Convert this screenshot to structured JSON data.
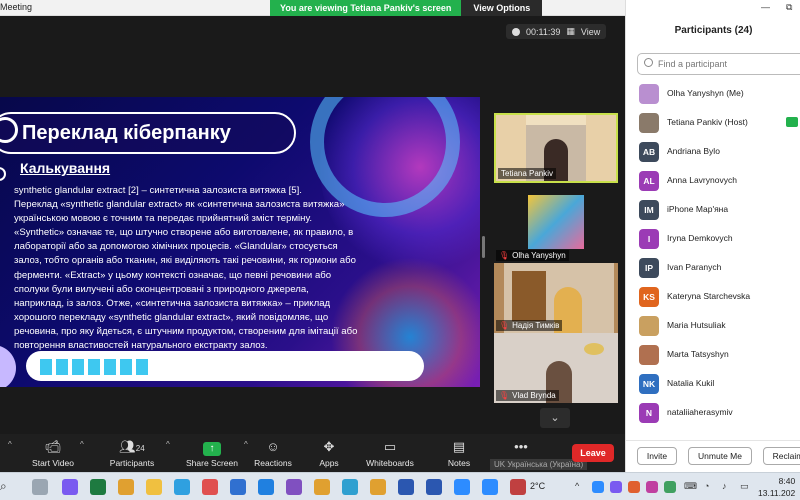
{
  "window": {
    "title": "Meeting"
  },
  "banner": {
    "message": "You are viewing Tetiana Pankiv's screen",
    "view_options": "View Options"
  },
  "meeting": {
    "timer": "00:11:39",
    "view_label": "View"
  },
  "slide": {
    "title": "Переклад кіберпанку",
    "subtitle": "Калькування",
    "lines": [
      " synthetic glandular extract [2] – синтетична залозиста витяжка [5].",
      "Переклад «synthetic glandular extract» як «синтетична залозиста витяжка»",
      "українською мовою є точним та передає прийнятний зміст терміну.",
      "«Synthetic» означає те, що штучно створене або виготовлене, як правило, в",
      "лабораторії або за допомогою хімічних процесів. «Glandular» стосується",
      "залоз, тобто органів або тканин, які виділяють такі речовини, як гормони або",
      "ферменти. «Extract» у цьому контексті означає, що певні речовини або",
      "сполуки були вилучені або сконцентровані з природного джерела,",
      "наприклад, із залоз. Отже, «синтетична залозиста витяжка» – приклад",
      "хорошого перекладу «synthetic glandular extract», який повідомляє, що",
      "речовина, про яку йдеться, є штучним продуктом, створеним для імітації або",
      "повторення властивостей натурального екстракту залоз."
    ],
    "progress_segments": 7
  },
  "tiles": [
    {
      "name": "Tetiana Pankiv",
      "muted": false
    },
    {
      "name": "Olha Yanyshyn",
      "muted": true
    },
    {
      "name": "Надія Тимків",
      "muted": true
    },
    {
      "name": "Vlad Brynda",
      "muted": true
    }
  ],
  "toolbar": {
    "video": "Start Video",
    "participants": "Participants",
    "participants_count": "24",
    "share": "Share Screen",
    "reactions": "Reactions",
    "apps": "Apps",
    "whiteboards": "Whiteboards",
    "notes": "Notes",
    "leave": "Leave",
    "lang_tip": "UK Українська (Україна)"
  },
  "panel": {
    "title": "Participants (24)",
    "search_placeholder": "Find a participant",
    "participants": [
      {
        "name": "Olha Yanyshyn (Me)",
        "initials": "",
        "color": "#b98fd0"
      },
      {
        "name": "Tetiana Pankiv (Host)",
        "initials": "",
        "color": "#8a7a6a"
      },
      {
        "name": "Andriana Bylo",
        "initials": "AB",
        "color": "#3d4a5c"
      },
      {
        "name": "Anna Lavrynovych",
        "initials": "AL",
        "color": "#9b3bb5"
      },
      {
        "name": "iPhone Мар'яна",
        "initials": "IM",
        "color": "#3d4a5c"
      },
      {
        "name": "Iryna Demkovych",
        "initials": "I",
        "color": "#9b3bb5"
      },
      {
        "name": "Ivan Paranych",
        "initials": "IP",
        "color": "#3d4a5c"
      },
      {
        "name": "Kateryna Starchevska",
        "initials": "KS",
        "color": "#e0651e"
      },
      {
        "name": "Maria Hutsuliak",
        "initials": "",
        "color": "#c9a060"
      },
      {
        "name": "Marta Tatsyshyn",
        "initials": "",
        "color": "#b07050"
      },
      {
        "name": "Natalia Kukil",
        "initials": "NK",
        "color": "#2f6fc0"
      },
      {
        "name": "nataliiaherasymiv",
        "initials": "N",
        "color": "#9b3bb5"
      }
    ],
    "invite": "Invite",
    "unmute_me": "Unmute Me",
    "reclaim": "Reclaim"
  },
  "taskbar": {
    "weather": "2°C",
    "time": "8:40",
    "date": "13.11.202"
  }
}
